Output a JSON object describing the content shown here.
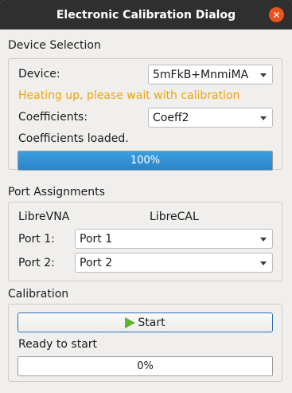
{
  "window": {
    "title": "Electronic Calibration Dialog",
    "close_icon": "close-icon"
  },
  "device_selection": {
    "heading": "Device Selection",
    "device_label": "Device:",
    "device_value": "5mFkB+MnmiMA",
    "warning": "Heating up, please wait with calibration",
    "coefficients_label": "Coefficients:",
    "coefficients_value": "Coeff2",
    "status": "Coefficients loaded.",
    "progress_text": "100%",
    "progress_value": 1.0
  },
  "port_assignments": {
    "heading": "Port Assignments",
    "col_left": "LibreVNA",
    "col_right": "LibreCAL",
    "rows": [
      {
        "label": "Port 1:",
        "value": "Port 1"
      },
      {
        "label": "Port 2:",
        "value": "Port 2"
      }
    ]
  },
  "calibration": {
    "heading": "Calibration",
    "start_label": "Start",
    "status": "Ready to start",
    "progress_text": "0%",
    "progress_value": 0.0
  },
  "colors": {
    "warning": "#f0a30a",
    "progress": "#2c83c8",
    "close": "#e9541e",
    "play": "#5fb52a"
  }
}
